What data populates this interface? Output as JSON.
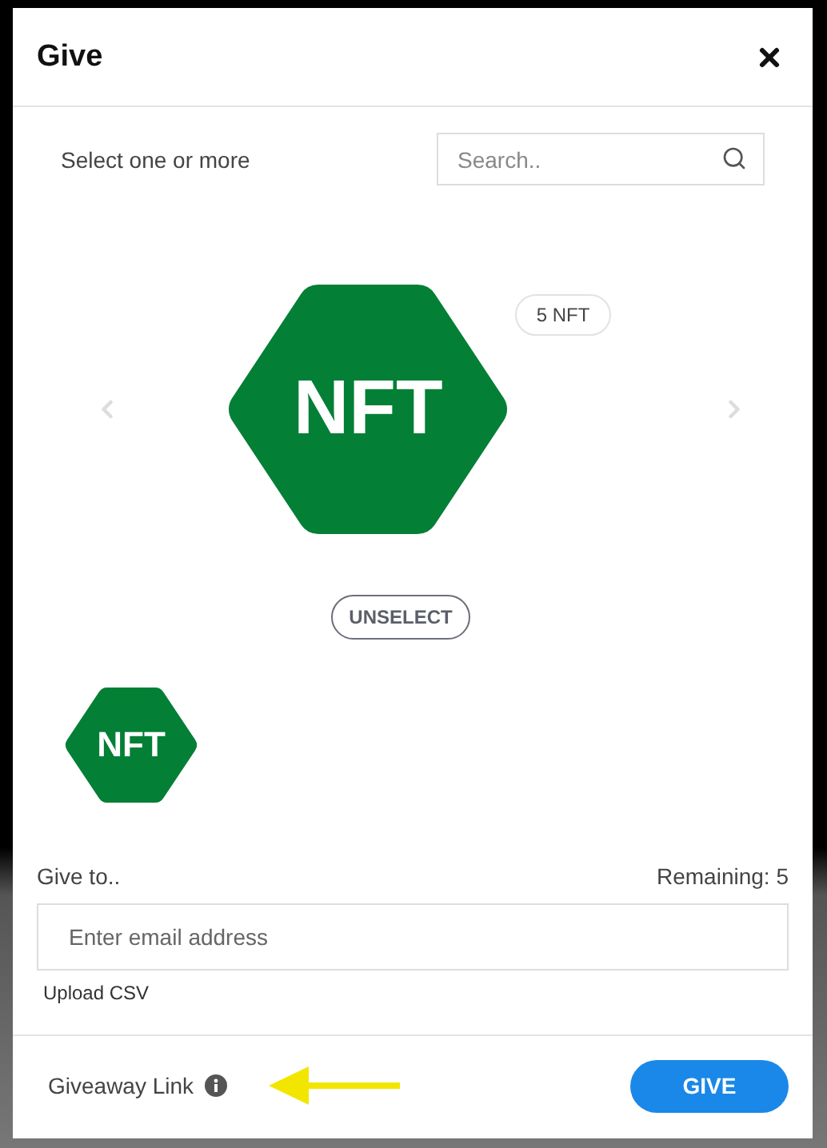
{
  "dialog": {
    "title": "Give"
  },
  "picker": {
    "instruction": "Select one or more",
    "search": {
      "placeholder": "Search.."
    }
  },
  "carousel": {
    "item": {
      "label": "NFT",
      "count": "5 NFT"
    },
    "unselect_button": "UNSELECT"
  },
  "selected_items": [
    {
      "label": "NFT"
    }
  ],
  "recipients": {
    "label": "Give to..",
    "remaining": "Remaining: 5",
    "email": {
      "placeholder": "Enter email address"
    },
    "upload_link": "Upload CSV"
  },
  "footer": {
    "giveaway_link": "Giveaway Link",
    "give_button": "GIVE"
  }
}
